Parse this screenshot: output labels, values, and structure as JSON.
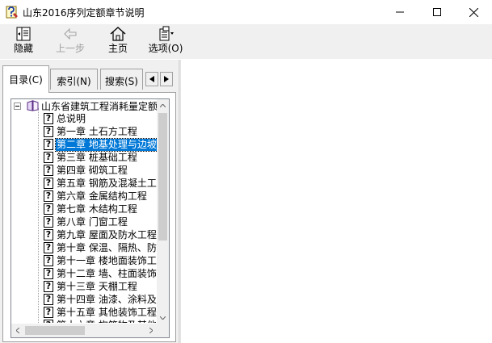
{
  "window": {
    "title": "山东2016序列定额章节说明",
    "minimize": "─",
    "maximize": "☐",
    "close": "✕"
  },
  "toolbar": {
    "hide_label": "隐藏",
    "back_label": "上一步",
    "home_label": "主页",
    "options_label": "选项(O)"
  },
  "tabs": {
    "contents": "目录(C)",
    "index": "索引(N)",
    "search": "搜索(S)",
    "prev_arrow": "◀",
    "next_arrow": "▶"
  },
  "tree": {
    "root": "山东省建筑工程消耗量定额",
    "items": [
      {
        "label": "总说明"
      },
      {
        "label": "第一章  土石方工程"
      },
      {
        "label": "第二章  地基处理与边坡",
        "selected": true
      },
      {
        "label": "第三章  桩基础工程"
      },
      {
        "label": "第四章  砌筑工程"
      },
      {
        "label": "第五章  钢筋及混凝土工"
      },
      {
        "label": "第六章  金属结构工程"
      },
      {
        "label": "第七章  木结构工程"
      },
      {
        "label": "第八章  门窗工程"
      },
      {
        "label": "第九章  屋面及防水工程"
      },
      {
        "label": "第十章  保温、隔热、防"
      },
      {
        "label": "第十一章  楼地面装饰工"
      },
      {
        "label": "第十二章  墙、柱面装饰"
      },
      {
        "label": "第十三章  天棚工程"
      },
      {
        "label": "第十四章  油漆、涂料及"
      },
      {
        "label": "第十五章  其他装饰工程"
      },
      {
        "label": "第十六章  构筑物及其他"
      }
    ]
  },
  "colors": {
    "selection": "#0078d7",
    "toolbar_bg": "#f0f0f0"
  }
}
